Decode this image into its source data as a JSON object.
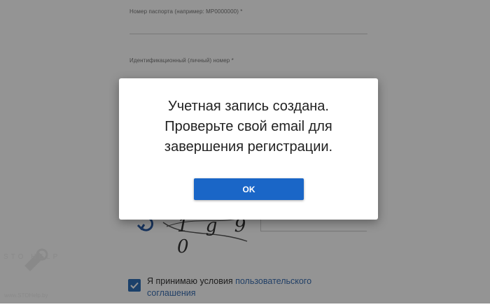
{
  "form": {
    "passport_label": "Номер паспорта (например: MP0000000) *",
    "id_label": "Идентификационный (личный) номер *",
    "captcha_text": "1 g 9 0",
    "terms_prefix": "Я принимаю условия ",
    "terms_link": "пользовательского соглашения",
    "checkbox_checked": true
  },
  "watermark": {
    "brand": "STO HELP",
    "url": "www.STOHelp.by"
  },
  "dialog": {
    "line1": "Учетная запись создана.",
    "line2": "Проверьте свой email для",
    "line3": "завершения регистрации.",
    "ok_label": "OK"
  },
  "colors": {
    "accent": "#1a66c7",
    "checkbox": "#2f6fb7",
    "link": "#3b6fb1",
    "overlay": "rgba(0,0,0,0.42)"
  }
}
